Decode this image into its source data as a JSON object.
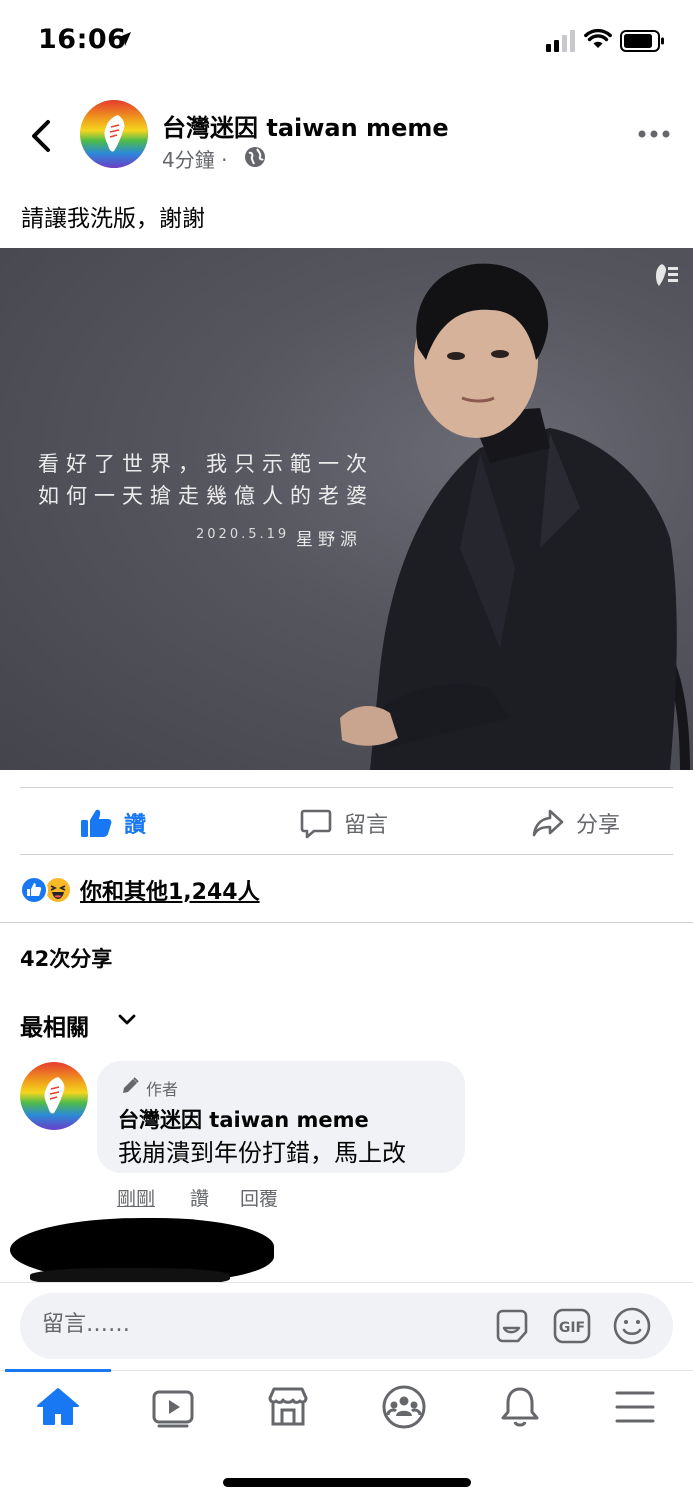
{
  "status_bar": {
    "time": "16:06"
  },
  "post": {
    "page_name": "台灣迷因 taiwan meme",
    "time": "4分鐘",
    "separator": "·",
    "text": "請讓我洗版，謝謝",
    "photo": {
      "quote_line1": "看好了世界，我只示範一次",
      "quote_line2": "如何一天搶走幾億人的老婆",
      "date": "2020.5.19",
      "author": "星野源"
    }
  },
  "actions": {
    "like": "讚",
    "comment": "留言",
    "share": "分享"
  },
  "reactions": {
    "summary": "你和其他1,244人"
  },
  "shares": "42次分享",
  "sort": {
    "label": "最相關"
  },
  "comment": {
    "badge": "作者",
    "name": "台灣迷因 taiwan meme",
    "text": "我崩潰到年份打錯，馬上改",
    "time": "剛剛",
    "like": "讚",
    "reply": "回覆"
  },
  "composer": {
    "placeholder": "留言……"
  },
  "colors": {
    "accent": "#1877f2",
    "muted": "#65676b",
    "bubble": "#f0f2f5"
  },
  "icons": {
    "tabs": [
      "home-icon",
      "watch-icon",
      "marketplace-icon",
      "groups-icon",
      "notifications-icon",
      "menu-icon"
    ],
    "composer": [
      "sticker-icon",
      "gif-icon",
      "emoji-icon"
    ]
  }
}
